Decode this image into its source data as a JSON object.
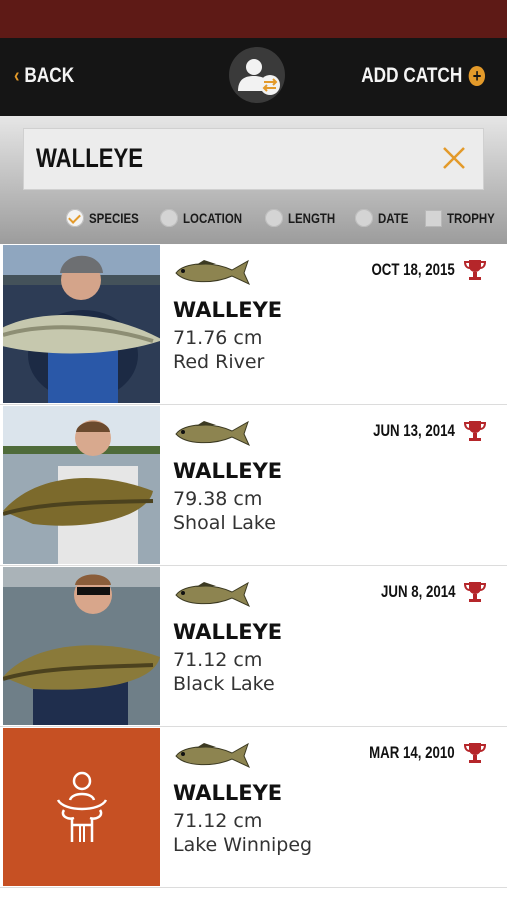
{
  "nav": {
    "back_label": "BACK",
    "add_label": "ADD CATCH"
  },
  "search": {
    "value": "WALLEYE"
  },
  "filters": [
    {
      "label": "SPECIES",
      "checked": true
    },
    {
      "label": "LOCATION",
      "checked": false
    },
    {
      "label": "LENGTH",
      "checked": false
    },
    {
      "label": "DATE",
      "checked": false
    },
    {
      "label": "TROPHY",
      "checked": false
    }
  ],
  "catches": [
    {
      "date": "OCT 18, 2015",
      "species": "WALLEYE",
      "length": "71.76 cm",
      "location": "Red River"
    },
    {
      "date": "JUN 13, 2014",
      "species": "WALLEYE",
      "length": "79.38 cm",
      "location": "Shoal Lake"
    },
    {
      "date": "JUN 8, 2014",
      "species": "WALLEYE",
      "length": "71.12 cm",
      "location": "Black Lake"
    },
    {
      "date": "MAR 14, 2010",
      "species": "WALLEYE",
      "length": "71.12 cm",
      "location": "Lake Winnipeg"
    }
  ],
  "colors": {
    "accent": "#e39a2a",
    "status_bar": "#5e1a16",
    "placeholder": "#c65023",
    "trophy": "#b5262a"
  },
  "icons": {
    "back": "chevron-left-icon",
    "profile": "switch-profile-icon",
    "add": "plus-circle-icon",
    "clear": "close-icon",
    "fish": "walleye-fish-icon",
    "trophy": "trophy-icon",
    "placeholder": "angler-placeholder-icon"
  }
}
